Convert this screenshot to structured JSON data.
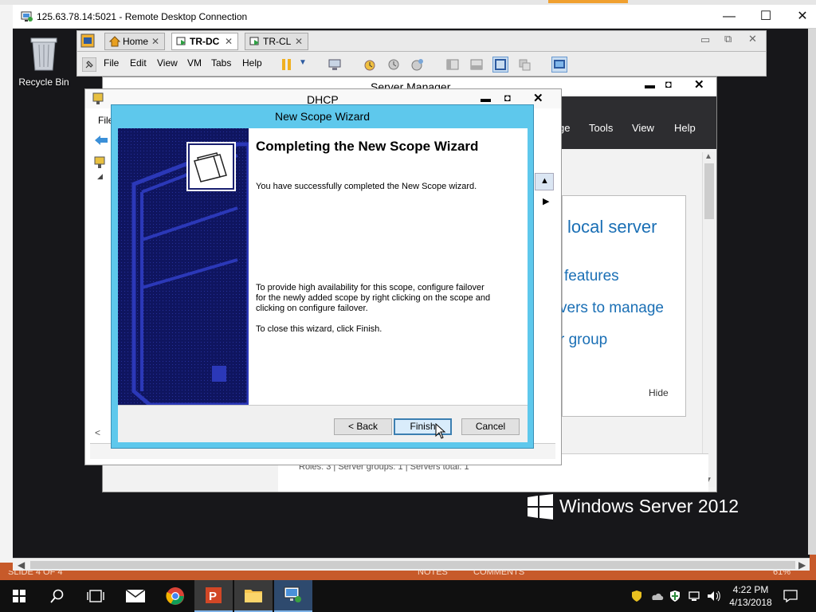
{
  "rdp": {
    "title": "125.63.78.14:5021 - Remote Desktop Connection",
    "minimize": "—",
    "maximize": "☐",
    "close": "✕"
  },
  "desktop": {
    "recycle_bin": "Recycle Bin"
  },
  "vmware": {
    "tabs": [
      {
        "label": "Home",
        "close": "✕"
      },
      {
        "label": "TR-DC",
        "close": "✕"
      },
      {
        "label": "TR-CL",
        "close": "✕"
      }
    ],
    "menu": [
      "File",
      "Edit",
      "View",
      "VM",
      "Tabs",
      "Help"
    ]
  },
  "server_manager": {
    "title": "Server Manager",
    "menu": [
      "ge",
      "Tools",
      "View",
      "Help"
    ],
    "links": [
      "local server",
      "features",
      "vers to manage",
      "r group"
    ],
    "hide": "Hide",
    "roles_line": "Roles: 3   |   Server groups: 1   |   Servers total: 1"
  },
  "dhcp": {
    "title": "DHCP",
    "menu_file": "File"
  },
  "wizard": {
    "title": "New Scope Wizard",
    "heading": "Completing the New Scope Wizard",
    "success": "You have successfully completed the New Scope wizard.",
    "failover": "To provide high availability for this scope, configure failover for the newly added scope by right clicking on the scope and clicking on configure failover.",
    "close_hint": "To close this wizard, click Finish.",
    "back": "< Back",
    "finish": "Finish",
    "cancel": "Cancel"
  },
  "branding": {
    "text": "Windows Server 2012"
  },
  "powerpoint_status": {
    "slide": "SLIDE 4 OF 4",
    "notes": "NOTES",
    "comments": "COMMENTS",
    "zoom": "61%"
  },
  "taskbar": {
    "time": "4:22 PM",
    "date": "4/13/2018"
  },
  "colors": {
    "wizard_title_bar": "#5ec8ec",
    "wizard_banner": "#0f1560",
    "server_manager_header": "#2d2d30",
    "link_blue": "#1a6fb5",
    "taskbar": "#101010"
  }
}
